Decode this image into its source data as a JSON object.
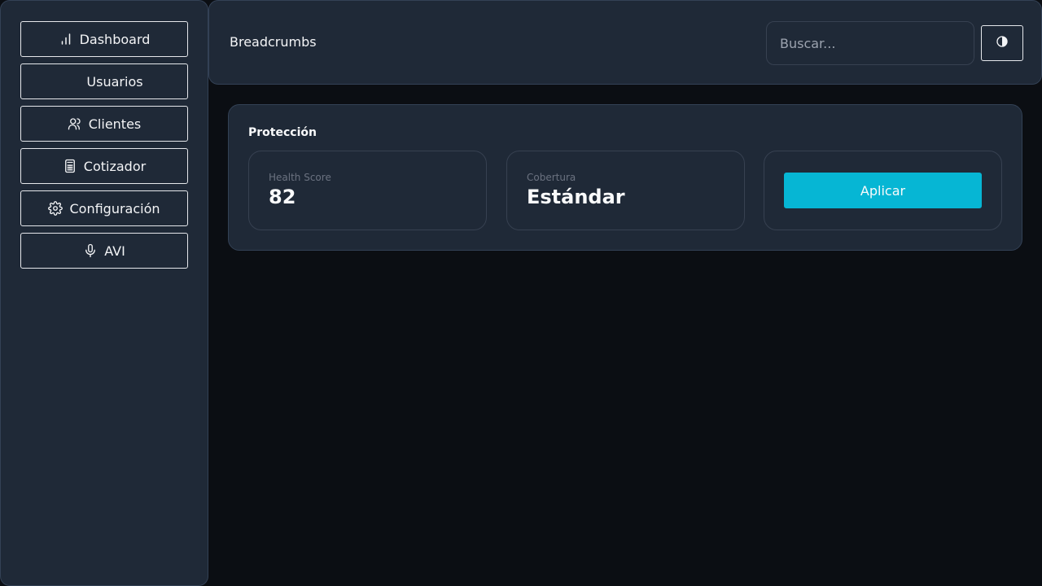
{
  "sidebar": {
    "items": [
      {
        "label": "Dashboard",
        "icon": "bar-chart-icon"
      },
      {
        "label": "Usuarios",
        "icon": ""
      },
      {
        "label": "Clientes",
        "icon": "users-icon"
      },
      {
        "label": "Cotizador",
        "icon": "calculator-icon"
      },
      {
        "label": "Configuración",
        "icon": "gear-icon"
      },
      {
        "label": "AVI",
        "icon": "microphone-icon"
      }
    ]
  },
  "header": {
    "breadcrumb": "Breadcrumbs",
    "search_placeholder": "Buscar...",
    "theme_toggle_icon": "contrast-icon"
  },
  "card": {
    "title": "Protección",
    "tiles": [
      {
        "label": "Health Score",
        "value": "82"
      },
      {
        "label": "Cobertura",
        "value": "Estándar"
      }
    ],
    "apply_label": "Aplicar"
  },
  "colors": {
    "background": "#0b0e13",
    "panel": "#1f2937",
    "accent": "#06b6d4"
  }
}
